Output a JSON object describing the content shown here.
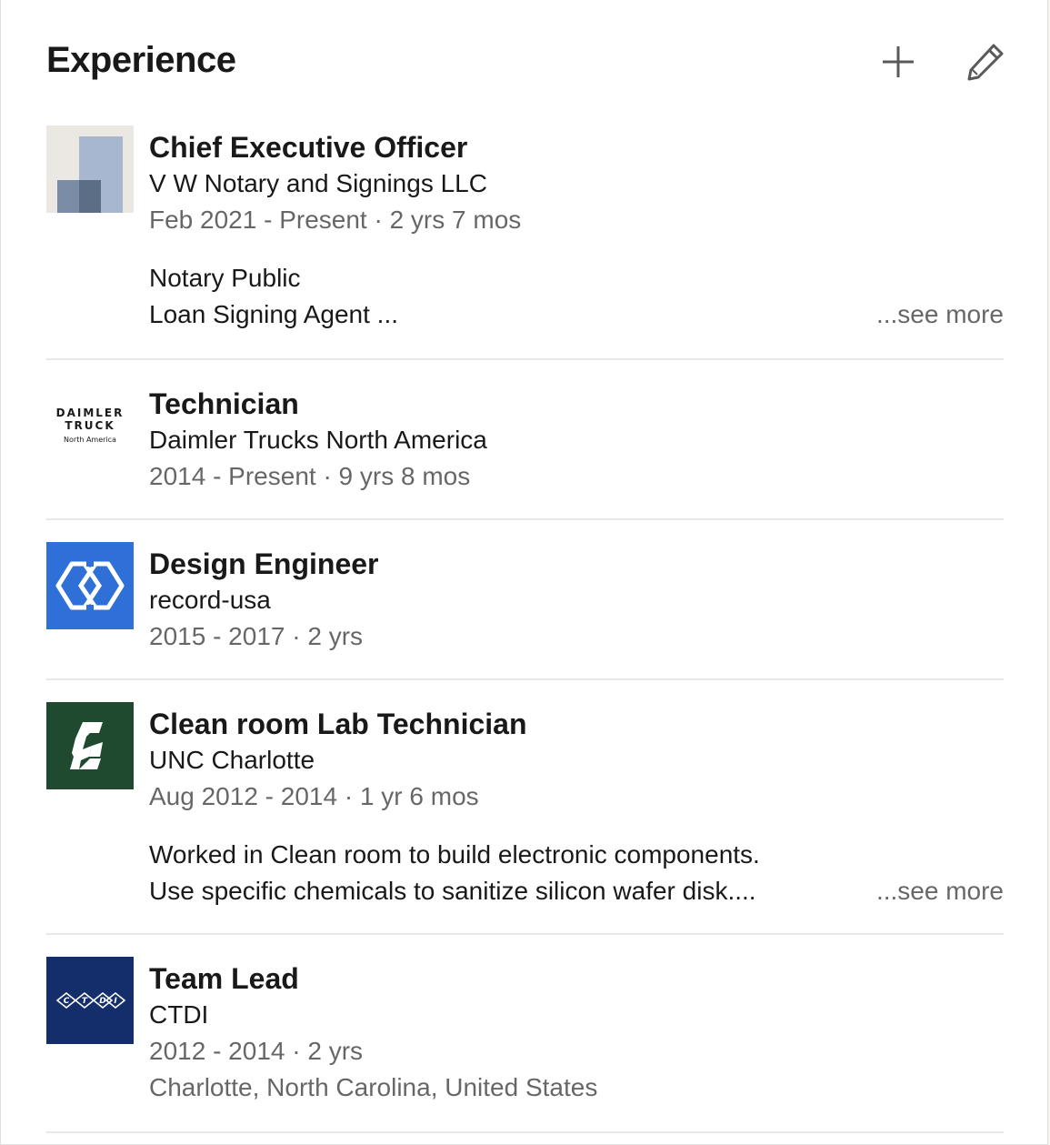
{
  "header": {
    "title": "Experience",
    "add_icon": "plus-icon",
    "edit_icon": "pencil-icon"
  },
  "colors": {
    "primary_text": "#191919",
    "secondary_text": "#666666",
    "divider": "#e8e8e8",
    "record_blue": "#2f6fd8",
    "unc_green": "#1f4a2f",
    "ctdi_navy": "#142e6b"
  },
  "experiences": [
    {
      "title": "Chief Executive Officer",
      "company": "V W Notary and Signings LLC",
      "dates": "Feb 2021 - Present · 2 yrs 7 mos",
      "logo": "vw-notary-logo",
      "description": [
        "Notary Public",
        "Loan Signing Agent ..."
      ],
      "see_more": "...see more"
    },
    {
      "title": "Technician",
      "company": "Daimler Trucks North America",
      "dates": "2014 - Present · 9 yrs 8 mos",
      "logo": "daimler-truck-logo",
      "logo_text": [
        "DAIMLER",
        "TRUCK",
        "North America"
      ]
    },
    {
      "title": "Design Engineer",
      "company": "record-usa",
      "dates": "2015 - 2017 · 2 yrs",
      "logo": "record-usa-logo"
    },
    {
      "title": "Clean room Lab Technician",
      "company": "UNC Charlotte",
      "dates": "Aug 2012 - 2014 · 1 yr 6 mos",
      "logo": "unc-charlotte-logo",
      "description": [
        "Worked in Clean room to build electronic components.",
        "Use specific chemicals to sanitize silicon wafer disk...."
      ],
      "see_more": "...see more"
    },
    {
      "title": "Team Lead",
      "company": "CTDI",
      "dates": "2012 - 2014 · 2 yrs",
      "location": "Charlotte, North Carolina, United States",
      "logo": "ctdi-logo",
      "logo_text": [
        "C",
        "T",
        "D",
        "I"
      ]
    }
  ]
}
